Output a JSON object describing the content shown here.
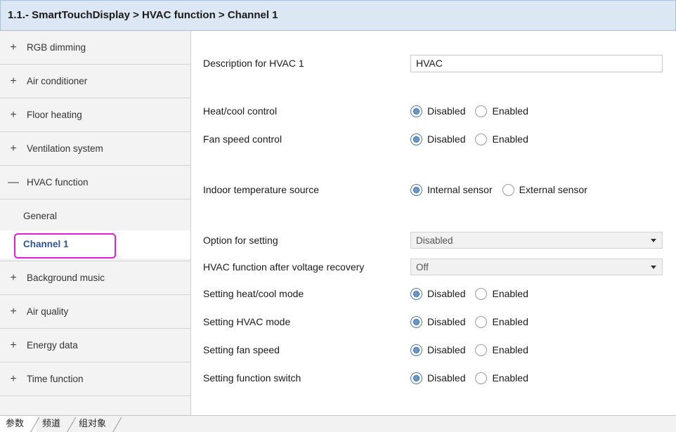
{
  "title": "1.1.- SmartTouchDisplay > HVAC function > Channel 1",
  "sidebar": {
    "items_top": [
      {
        "sign": "+",
        "label": "RGB dimming"
      },
      {
        "sign": "+",
        "label": "Air conditioner"
      },
      {
        "sign": "+",
        "label": "Floor heating"
      },
      {
        "sign": "+",
        "label": "Ventilation system"
      },
      {
        "sign": "—",
        "label": "HVAC function"
      }
    ],
    "sub_items": [
      {
        "label": "General"
      },
      {
        "label": "Channel 1"
      }
    ],
    "items_bottom": [
      {
        "sign": "+",
        "label": "Background music"
      },
      {
        "sign": "+",
        "label": "Air quality"
      },
      {
        "sign": "+",
        "label": "Energy data"
      },
      {
        "sign": "+",
        "label": "Time function"
      }
    ]
  },
  "form": {
    "description": {
      "label": "Description for HVAC 1",
      "value": "HVAC"
    },
    "heat_cool_control": {
      "label": "Heat/cool control",
      "options": [
        "Disabled",
        "Enabled"
      ],
      "selected": "Disabled"
    },
    "fan_speed_control": {
      "label": "Fan speed control",
      "options": [
        "Disabled",
        "Enabled"
      ],
      "selected": "Disabled"
    },
    "indoor_temp_source": {
      "label": "Indoor temperature source",
      "options": [
        "Internal sensor",
        "External sensor"
      ],
      "selected": "Internal sensor"
    },
    "option_for_setting": {
      "label": "Option for setting",
      "value": "Disabled"
    },
    "after_voltage_recovery": {
      "label": "HVAC function after voltage recovery",
      "value": "Off"
    },
    "setting_heat_cool_mode": {
      "label": "Setting heat/cool mode",
      "options": [
        "Disabled",
        "Enabled"
      ],
      "selected": "Disabled"
    },
    "setting_hvac_mode": {
      "label": "Setting HVAC mode",
      "options": [
        "Disabled",
        "Enabled"
      ],
      "selected": "Disabled"
    },
    "setting_fan_speed": {
      "label": "Setting fan speed",
      "options": [
        "Disabled",
        "Enabled"
      ],
      "selected": "Disabled"
    },
    "setting_function_switch": {
      "label": "Setting function switch",
      "options": [
        "Disabled",
        "Enabled"
      ],
      "selected": "Disabled"
    }
  },
  "bottom_tabs": [
    "参数",
    "频道",
    "组对象"
  ]
}
